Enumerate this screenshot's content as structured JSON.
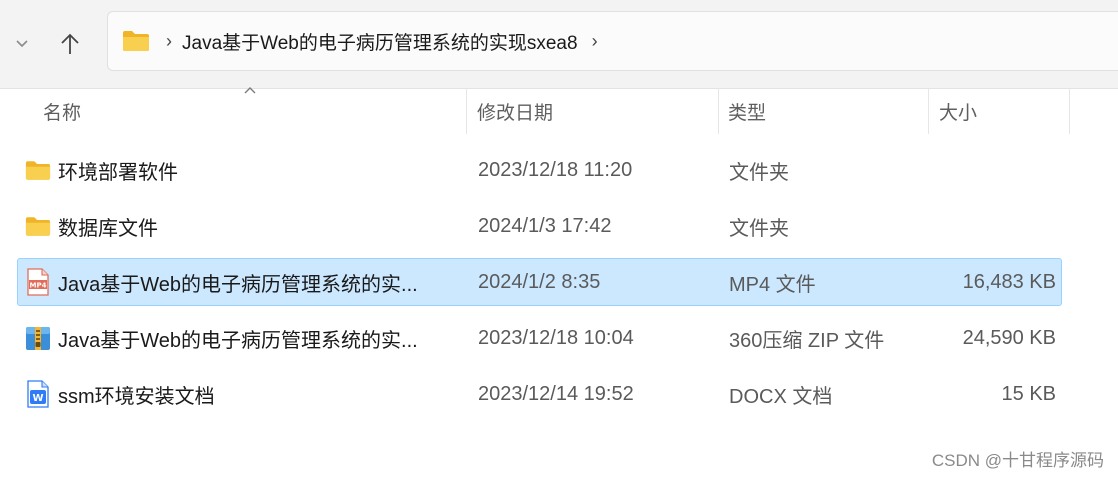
{
  "address": {
    "path_segment": "Java基于Web的电子病历管理系统的实现sxea8"
  },
  "columns": {
    "name": "名称",
    "date": "修改日期",
    "type": "类型",
    "size": "大小"
  },
  "rows": [
    {
      "name": "环境部署软件",
      "date": "2023/12/18 11:20",
      "type": "文件夹",
      "size": "",
      "icon": "folder-icon"
    },
    {
      "name": "数据库文件",
      "date": "2024/1/3 17:42",
      "type": "文件夹",
      "size": "",
      "icon": "folder-icon"
    },
    {
      "name": "Java基于Web的电子病历管理系统的实...",
      "date": "2024/1/2 8:35",
      "type": "MP4 文件",
      "size": "16,483 KB",
      "icon": "mp4-file-icon",
      "icon_label": "MP4",
      "selected": true
    },
    {
      "name": "Java基于Web的电子病历管理系统的实...",
      "date": "2023/12/18 10:04",
      "type": "360压缩 ZIP 文件",
      "size": "24,590 KB",
      "icon": "zip-archive-icon"
    },
    {
      "name": "ssm环境安装文档",
      "date": "2023/12/14 19:52",
      "type": "DOCX 文档",
      "size": "15 KB",
      "icon": "wps-doc-icon",
      "icon_label": "W"
    }
  ],
  "watermark": "CSDN @十甘程序源码",
  "colors": {
    "selection_bg": "#cce8ff",
    "selection_border": "#99d1ff",
    "folder": "#f8c845"
  }
}
